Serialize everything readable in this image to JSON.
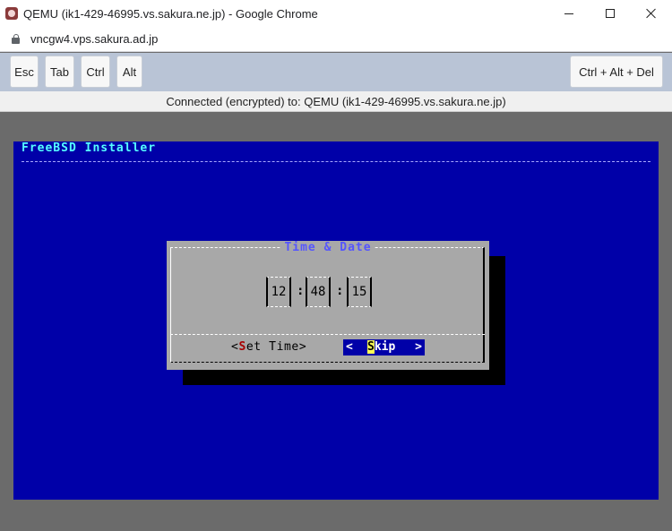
{
  "browser": {
    "window_title": "QEMU (ik1-429-46995.vs.sakura.ne.jp) - Google Chrome",
    "url": "vncgw4.vps.sakura.ad.jp"
  },
  "toolbar": {
    "esc_label": "Esc",
    "tab_label": "Tab",
    "ctrl_label": "Ctrl",
    "alt_label": "Alt",
    "ctrl_alt_del_label": "Ctrl + Alt + Del"
  },
  "status": {
    "text": "Connected (encrypted) to: QEMU (ik1-429-46995.vs.sakura.ne.jp)"
  },
  "installer": {
    "title": "FreeBSD Installer",
    "dialog": {
      "title": "Time & Date",
      "hour": "12",
      "minute": "48",
      "second": "15",
      "separator": ":",
      "set_time_prefix": "<",
      "set_time_hotkey": "S",
      "set_time_rest": "et Time>",
      "skip_left": "<",
      "skip_hotkey": "S",
      "skip_rest": "kip",
      "skip_right": ">"
    },
    "colors": {
      "screen_bg": "#0000a8",
      "dialog_bg": "#a8a8a8",
      "title_text": "#55ffff",
      "hotkey": "#a80000",
      "focus_hotkey_bg": "#ffff55"
    }
  }
}
